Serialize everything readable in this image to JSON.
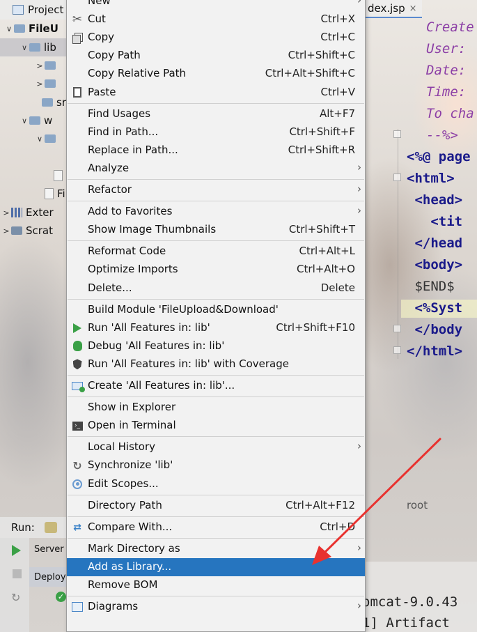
{
  "ide": {
    "project_label": "Project",
    "tree": [
      {
        "text": "FileU",
        "arrow": "∨",
        "bold": true
      },
      {
        "text": "lib",
        "arrow": "∨",
        "selected": true
      },
      {
        "text": "",
        "arrow": ">"
      },
      {
        "text": "",
        "arrow": ">"
      },
      {
        "text": "sr",
        "arrow": ""
      },
      {
        "text": "w",
        "arrow": "∨"
      },
      {
        "text": "",
        "arrow": "∨"
      },
      {
        "text": "",
        "arrow": ""
      },
      {
        "text": "",
        "arrow": ""
      },
      {
        "text": "Fi",
        "arrow": ""
      },
      {
        "text": "Exter",
        "arrow": ">"
      },
      {
        "text": "Scrat",
        "arrow": ">"
      }
    ],
    "editor_tab": "dex.jsp",
    "code_lines": [
      {
        "text": "Create",
        "kind": "c"
      },
      {
        "text": "User:",
        "kind": "c"
      },
      {
        "text": "Date:",
        "kind": "c"
      },
      {
        "text": "Time:",
        "kind": "c"
      },
      {
        "text": "To cha",
        "kind": "c"
      },
      {
        "text": "--%>",
        "kind": "c"
      },
      {
        "text": "<%@ page",
        "kind": "t"
      },
      {
        "text": "<html>",
        "kind": "t"
      },
      {
        "text": " <head>",
        "kind": "t"
      },
      {
        "text": "   <tit",
        "kind": "t"
      },
      {
        "text": " </head",
        "kind": "t"
      },
      {
        "text": " <body>",
        "kind": "t"
      },
      {
        "text": " $END$",
        "kind": "p"
      },
      {
        "text": " <%Syst",
        "kind": "t"
      },
      {
        "text": " </body",
        "kind": "t"
      },
      {
        "text": "</html>",
        "kind": "t"
      }
    ],
    "breadcrumb": "root",
    "run_label": "Run:",
    "run_items": [
      "Server",
      "Deploy"
    ],
    "console_lines": [
      "omcat-9.0.43",
      "1] Artifact"
    ]
  },
  "menu": {
    "items": [
      {
        "label": "New",
        "shortcut": "",
        "sub": true,
        "icon": ""
      },
      {
        "label": "Cut",
        "shortcut": "Ctrl+X",
        "icon": "scissors-icon"
      },
      {
        "label": "Copy",
        "shortcut": "Ctrl+C",
        "icon": "copy-icon"
      },
      {
        "label": "Copy Path",
        "shortcut": "Ctrl+Shift+C",
        "icon": ""
      },
      {
        "label": "Copy Relative Path",
        "shortcut": "Ctrl+Alt+Shift+C",
        "icon": ""
      },
      {
        "label": "Paste",
        "shortcut": "Ctrl+V",
        "icon": "clipboard-icon",
        "sep_after": true
      },
      {
        "label": "Find Usages",
        "shortcut": "Alt+F7",
        "icon": ""
      },
      {
        "label": "Find in Path...",
        "shortcut": "Ctrl+Shift+F",
        "icon": ""
      },
      {
        "label": "Replace in Path...",
        "shortcut": "Ctrl+Shift+R",
        "icon": ""
      },
      {
        "label": "Analyze",
        "shortcut": "",
        "sub": true,
        "icon": "",
        "sep_after": true
      },
      {
        "label": "Refactor",
        "shortcut": "",
        "sub": true,
        "icon": "",
        "sep_after": true
      },
      {
        "label": "Add to Favorites",
        "shortcut": "",
        "sub": true,
        "icon": ""
      },
      {
        "label": "Show Image Thumbnails",
        "shortcut": "Ctrl+Shift+T",
        "icon": "",
        "sep_after": true
      },
      {
        "label": "Reformat Code",
        "shortcut": "Ctrl+Alt+L",
        "icon": ""
      },
      {
        "label": "Optimize Imports",
        "shortcut": "Ctrl+Alt+O",
        "icon": ""
      },
      {
        "label": "Delete...",
        "shortcut": "Delete",
        "icon": "",
        "sep_after": true
      },
      {
        "label": "Build Module 'FileUpload&Download'",
        "shortcut": "",
        "icon": ""
      },
      {
        "label": "Run 'All Features in: lib'",
        "shortcut": "Ctrl+Shift+F10",
        "icon": "run-icon"
      },
      {
        "label": "Debug 'All Features in: lib'",
        "shortcut": "",
        "icon": "debug-icon"
      },
      {
        "label": "Run 'All Features in: lib' with Coverage",
        "shortcut": "",
        "icon": "coverage-icon",
        "sep_after": true
      },
      {
        "label": "Create 'All Features in: lib'...",
        "shortcut": "",
        "icon": "create-config-icon",
        "sep_after": true
      },
      {
        "label": "Show in Explorer",
        "shortcut": "",
        "icon": ""
      },
      {
        "label": "Open in Terminal",
        "shortcut": "",
        "icon": "terminal-icon",
        "sep_after": true
      },
      {
        "label": "Local History",
        "shortcut": "",
        "sub": true,
        "icon": ""
      },
      {
        "label": "Synchronize 'lib'",
        "shortcut": "",
        "icon": "sync-icon"
      },
      {
        "label": "Edit Scopes...",
        "shortcut": "",
        "icon": "scope-icon",
        "sep_after": true
      },
      {
        "label": "Directory Path",
        "shortcut": "Ctrl+Alt+F12",
        "icon": "",
        "sep_after": true
      },
      {
        "label": "Compare With...",
        "shortcut": "Ctrl+D",
        "icon": "compare-icon",
        "sep_after": true
      },
      {
        "label": "Mark Directory as",
        "shortcut": "",
        "sub": true,
        "icon": ""
      },
      {
        "label": "Add as Library...",
        "shortcut": "",
        "icon": "",
        "highlighted": true
      },
      {
        "label": "Remove BOM",
        "shortcut": "",
        "icon": "",
        "sep_after": true
      },
      {
        "label": "Diagrams",
        "shortcut": "",
        "sub": true,
        "icon": "diagram-icon"
      }
    ]
  },
  "colors": {
    "highlight": "#2675bf",
    "annotation_arrow": "#e8322f"
  }
}
